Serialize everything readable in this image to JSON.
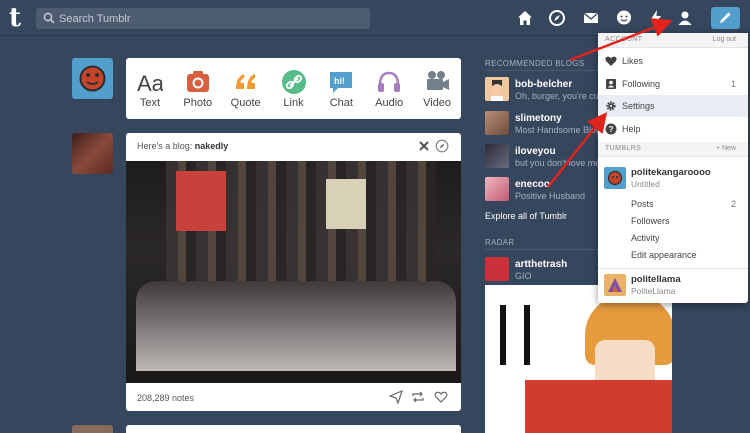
{
  "header": {
    "logo": "t",
    "search_placeholder": "Search Tumblr",
    "colors": {
      "background": "#36465d",
      "compose": "#529ecc"
    }
  },
  "post_types": [
    {
      "label": "Text",
      "icon": "text-icon",
      "color": "#444444"
    },
    {
      "label": "Photo",
      "icon": "camera-icon",
      "color": "#d95e40"
    },
    {
      "label": "Quote",
      "icon": "quote-icon",
      "color": "#f2992e"
    },
    {
      "label": "Link",
      "icon": "link-icon",
      "color": "#56bc8a"
    },
    {
      "label": "Chat",
      "icon": "chat-icon",
      "color": "#529ecc"
    },
    {
      "label": "Audio",
      "icon": "headphones-icon",
      "color": "#a77dc2"
    },
    {
      "label": "Video",
      "icon": "video-camera-icon",
      "color": "#748089"
    }
  ],
  "post": {
    "prefix": "Here's a blog:",
    "blog": "nakedly",
    "notes": "208,289 notes"
  },
  "recommended": {
    "title": "RECOMMENDED BLOGS",
    "items": [
      {
        "name": "bob-belcher",
        "sub": "Oh, burger, you're cute"
      },
      {
        "name": "slimetony",
        "sub": "Most Handsome Blog"
      },
      {
        "name": "iloveyou",
        "sub": "but you don't love me"
      },
      {
        "name": "enecoo",
        "sub": "Positive Husband"
      }
    ],
    "explore": "Explore all of Tumblr"
  },
  "radar": {
    "title": "RADAR",
    "name": "artthetrash",
    "sub": "GIO"
  },
  "menu": {
    "account_title": "ACCOUNT",
    "logout": "Log out",
    "items": [
      {
        "label": "Likes",
        "count": ""
      },
      {
        "label": "Following",
        "count": "1"
      },
      {
        "label": "Settings",
        "count": ""
      },
      {
        "label": "Help",
        "count": ""
      }
    ],
    "tumblrs_title": "TUMBLRS",
    "new_label": "+ New",
    "blogs": [
      {
        "name": "politekangaroooo",
        "sub": "Untitled",
        "subitems": [
          {
            "label": "Posts",
            "count": "2"
          },
          {
            "label": "Followers",
            "count": ""
          },
          {
            "label": "Activity",
            "count": ""
          },
          {
            "label": "Edit appearance",
            "count": ""
          }
        ]
      },
      {
        "name": "politellama",
        "sub": "PoliteLlama"
      }
    ]
  }
}
